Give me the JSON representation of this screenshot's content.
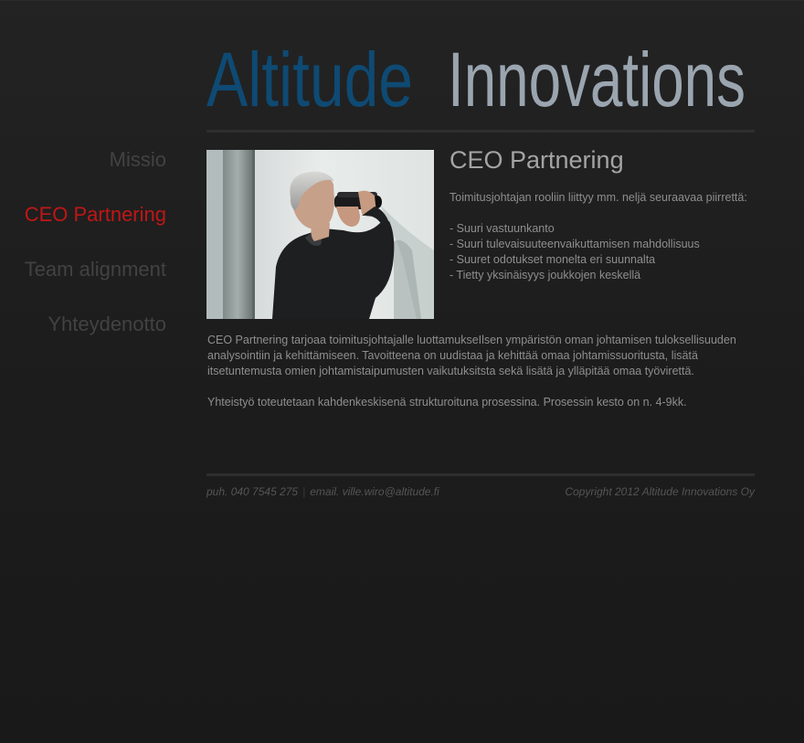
{
  "logo": {
    "word1": "Altitude",
    "word2": "Innovations",
    "color1": "#0e4a73",
    "color2": "#9aa5b0"
  },
  "nav": {
    "items": [
      {
        "label": "Missio",
        "active": false
      },
      {
        "label": "CEO Partnering",
        "active": true
      },
      {
        "label": "Team alignment",
        "active": false
      },
      {
        "label": "Yhteydenotto",
        "active": false
      }
    ],
    "active_color": "#c01616",
    "inactive_color": "#424242"
  },
  "content": {
    "title": "CEO Partnering",
    "intro": "Toimitusjohtajan rooliin liittyy mm. neljä seuraavaa piirrettä:",
    "bullets": [
      "- Suuri vastuunkanto",
      "- Suuri tulevaisuuteenvaikuttamisen mahdollisuus",
      "- Suuret odotukset monelta eri suunnalta",
      "- Tietty yksinäisyys joukkojen keskellä"
    ],
    "paragraph1": "CEO Partnering tarjoaa toimitusjohtajalle luottamukseIlsen ympäristön oman johtamisen tuloksellisuuden analysointiin  ja kehittämiseen. Tavoitteena on uudistaa ja kehittää omaa johtamissuoritusta, lisätä itsetuntemusta omien johtamistaipumusten vaikutuksitsta sekä lisätä ja ylläpitää omaa työvirettä.",
    "paragraph2": "Yhteistyö toteutetaan kahdenkeskisenä strukturoituna prosessina. Prosessin kesto on n. 4-9kk.",
    "photo_icon": "man-with-binoculars-photo"
  },
  "footer": {
    "phone": "puh. 040 7545 275",
    "separator": "|",
    "email": "email. ville.wiro@altitude.fi",
    "copyright": "Copyright 2012 Altitude Innovations Oy"
  }
}
